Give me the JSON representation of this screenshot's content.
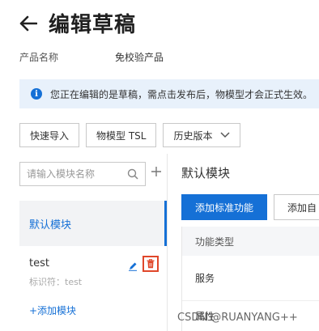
{
  "header": {
    "title": "编辑草稿",
    "back_icon": "arrow-left-icon"
  },
  "product": {
    "name_label": "产品名称",
    "name_value": "免校验产品"
  },
  "notice": {
    "icon": "info-icon",
    "text": "您正在编辑的是草稿，需点击发布后，物模型才会正式生效。"
  },
  "toolbar": {
    "quick_import": "快速导入",
    "tsl": "物模型 TSL",
    "history": "历史版本"
  },
  "sidebar": {
    "search_placeholder": "请输入模块名称",
    "modules": [
      {
        "name": "默认模块",
        "selected": true
      },
      {
        "name": "test",
        "identifier": "标识符：test"
      }
    ],
    "add_module": "+添加模块"
  },
  "main": {
    "title": "默认模块",
    "add_standard": "添加标准功能",
    "add_custom": "添加自",
    "table": {
      "header": "功能类型",
      "rows": [
        "服务",
        "属性"
      ]
    }
  },
  "watermark": "CSDN @RUANYANG++",
  "colors": {
    "primary": "#1570d6",
    "danger": "#e0472a",
    "notice_bg": "#e8f1fb"
  }
}
